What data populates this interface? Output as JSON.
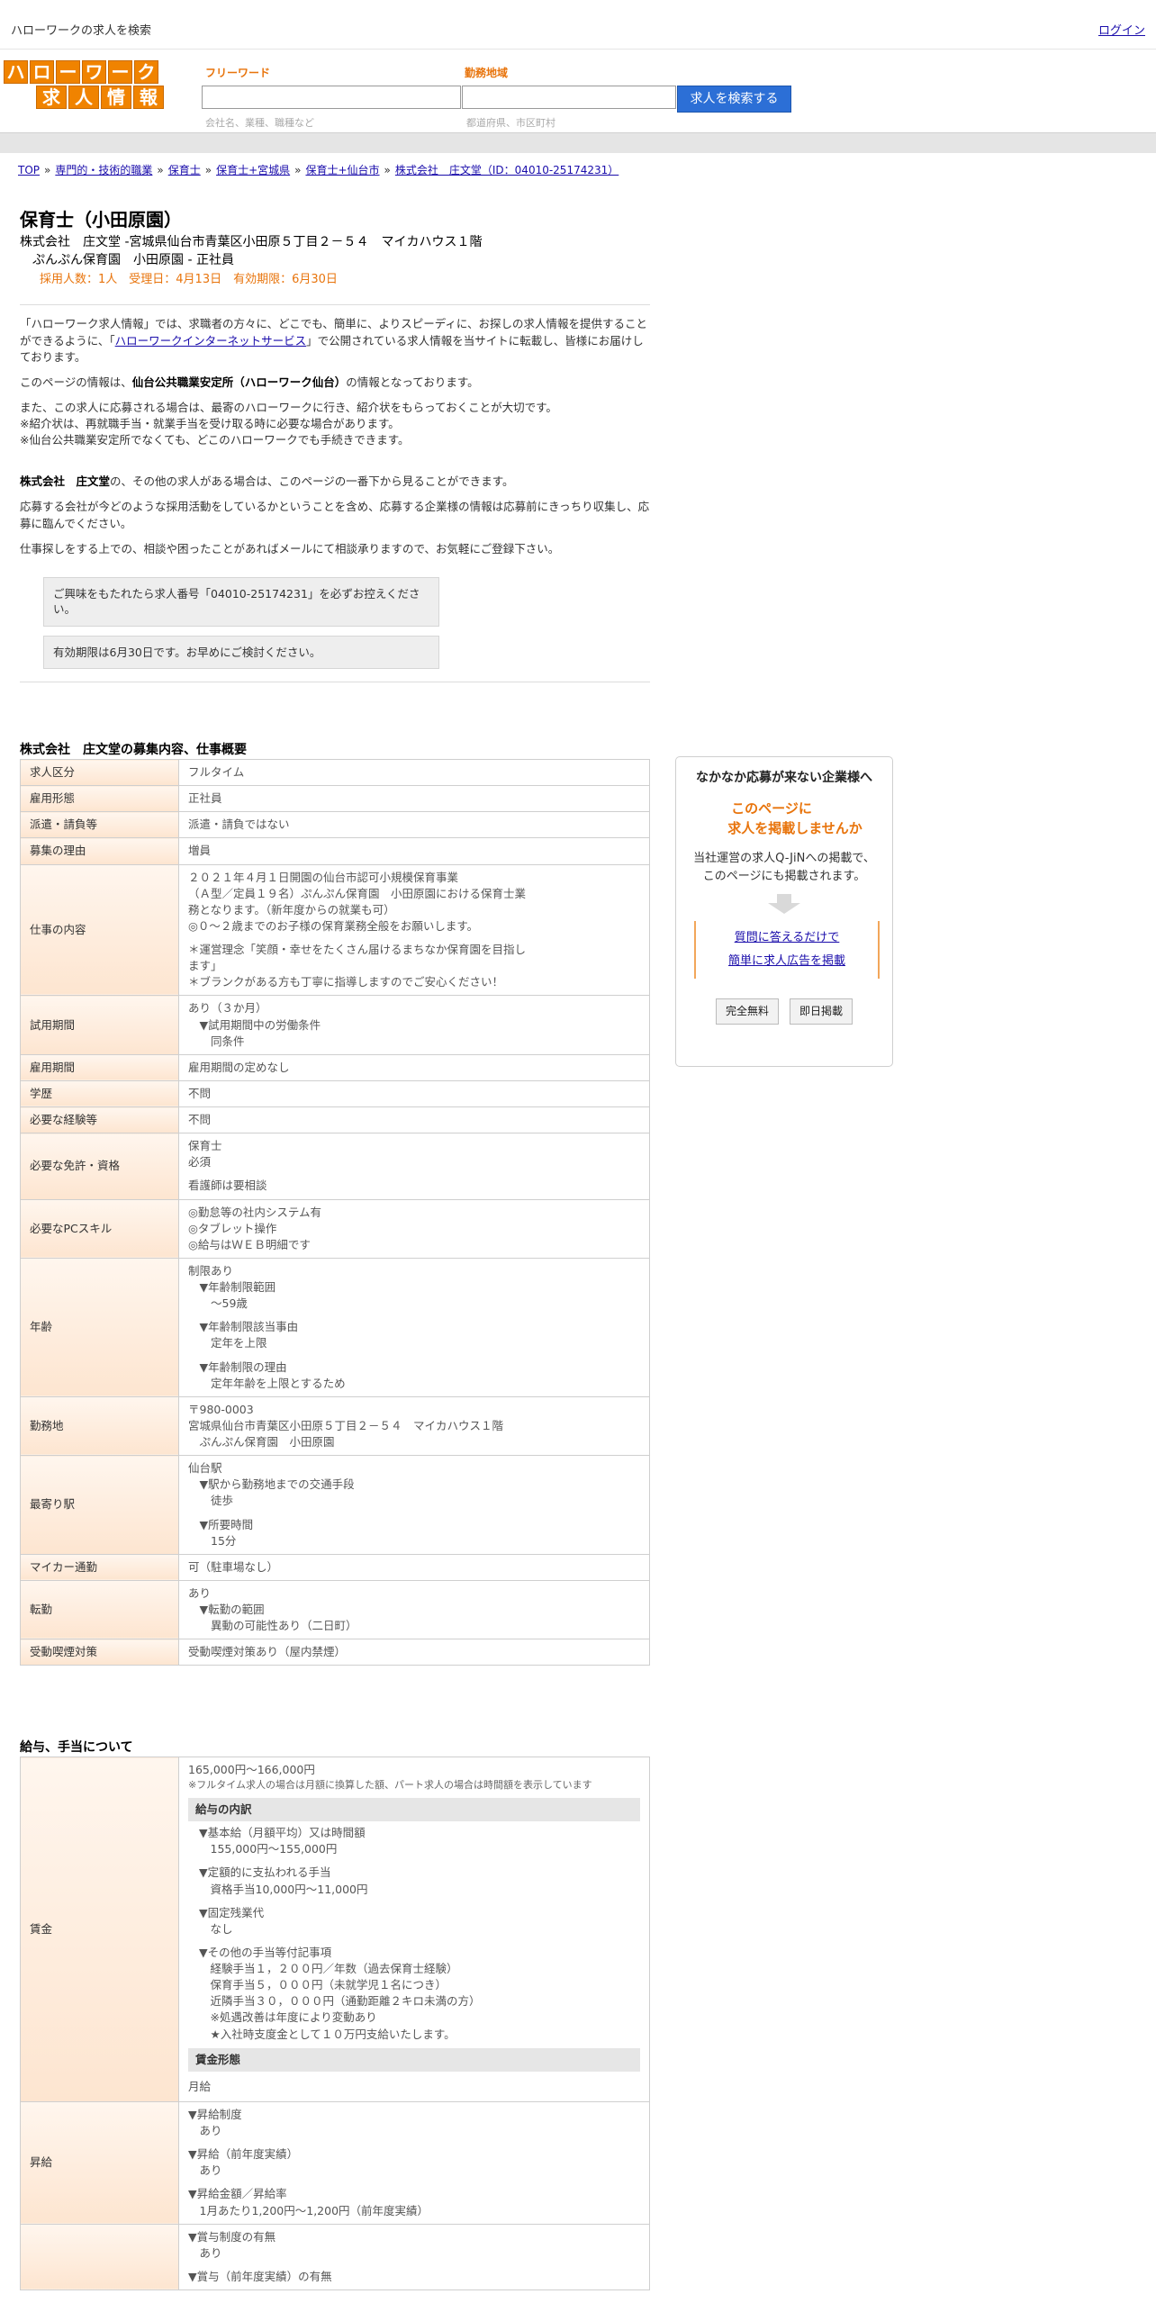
{
  "topbar": {
    "title": "ハローワークの求人を検索",
    "login": "ログイン"
  },
  "logo": {
    "row1": [
      "ハ",
      "ロ",
      "ー",
      "ワ",
      "ー",
      "ク"
    ],
    "row2": [
      "求",
      "人",
      "情",
      "報"
    ]
  },
  "search": {
    "freeword_label": "フリーワード",
    "freeword_hint": "会社名、業種、職種など",
    "area_label": "勤務地域",
    "area_hint": "都道府県、市区町村",
    "button": "求人を検索する"
  },
  "breadcrumb": [
    "TOP",
    "専門的・技術的職業",
    "保育士",
    "保育士+宮城県",
    "保育士+仙台市",
    "株式会社　庄文堂（ID：04010-25174231）"
  ],
  "breadcrumb_sep": "»",
  "job": {
    "title": "保育士（小田原園）",
    "company": "株式会社　庄文堂 -宮城県仙台市青葉区小田原５丁目２－５４　マイカハウス１階",
    "sub": "ぷんぷん保育園　小田原園 - 正社員",
    "meta": "採用人数：1人　受理日：4月13日　有効期限：6月30日"
  },
  "intro": {
    "p1a": "「ハローワーク求人情報」では、求職者の方々に、どこでも、簡単に、よりスピーディに、お探しの求人情報を提供することができるように、「",
    "p1link": "ハローワークインターネットサービス",
    "p1b": "」で公開されている求人情報を当サイトに転載し、皆様にお届けしております。",
    "p2a": "このページの情報は、",
    "p2b": "仙台公共職業安定所（ハローワーク仙台）",
    "p2c": "の情報となっております。",
    "p3": "また、この求人に応募される場合は、最寄のハローワークに行き、紹介状をもらっておくことが大切です。",
    "p3n1": "※紹介状は、再就職手当・就業手当を受け取る時に必要な場合があります。",
    "p3n2": "※仙台公共職業安定所でなくても、どこのハローワークでも手続きできます。",
    "p4a": "株式会社　庄文堂",
    "p4b": "の、その他の求人がある場合は、このページの一番下から見ることができます。",
    "p5": "応募する会社が今どのような採用活動をしているかということを含め、応募する企業様の情報は応募前にきっちり収集し、応募に臨んでください。",
    "p6": "仕事探しをする上での、相談や困ったことがあればメールにて相談承りますので、お気軽にご登録下さい。",
    "notice1": "ご興味をもたれたら求人番号「04010-25174231」を必ずお控えください。",
    "notice2": "有効期限は6月30日です。お早めにご検討ください。"
  },
  "overview": {
    "title": "株式会社　庄文堂の募集内容、仕事概要",
    "rows": [
      {
        "k": "求人区分",
        "v": [
          "フルタイム"
        ]
      },
      {
        "k": "雇用形態",
        "v": [
          "正社員"
        ]
      },
      {
        "k": "派遣・請負等",
        "v": [
          "派遣・請負ではない"
        ]
      },
      {
        "k": "募集の理由",
        "v": [
          "増員"
        ]
      },
      {
        "k": "仕事の内容",
        "v": [
          "２０２１年４月１日開園の仙台市認可小規模保育事業",
          "（Ａ型／定員１９名）ぷんぷん保育園　小田原園における保育士業",
          "務となります。（新年度からの就業も可）",
          "◎０～２歳までのお子様の保育業務全般をお願いします。",
          "",
          "＊運営理念「笑顔・幸せをたくさん届けるまちなか保育園を目指し",
          "ます」",
          "＊ブランクがある方も丁寧に指導しますのでご安心ください！"
        ]
      },
      {
        "k": "試用期間",
        "v": [
          "あり（３か月）",
          "　▼試用期間中の労働条件",
          "　　同条件"
        ]
      },
      {
        "k": "雇用期間",
        "v": [
          "雇用期間の定めなし"
        ]
      },
      {
        "k": "学歴",
        "v": [
          "不問"
        ]
      },
      {
        "k": "必要な経験等",
        "v": [
          "不問"
        ]
      },
      {
        "k": "必要な免許・資格",
        "v": [
          "保育士",
          "必須",
          "",
          "看護師は要相談"
        ]
      },
      {
        "k": "必要なPCスキル",
        "v": [
          "◎勤怠等の社内システム有",
          "◎タブレット操作",
          "◎給与はＷＥＢ明細です"
        ]
      },
      {
        "k": "年齢",
        "v": [
          "制限あり",
          "　▼年齢制限範囲",
          "　　〜59歳",
          "",
          "　▼年齢制限該当事由",
          "　　定年を上限",
          "",
          "　▼年齢制限の理由",
          "　　定年年齢を上限とするため"
        ]
      },
      {
        "k": "勤務地",
        "v": [
          "〒980-0003",
          "宮城県仙台市青葉区小田原５丁目２－５４　マイカハウス１階",
          "　ぷんぷん保育園　小田原園"
        ]
      },
      {
        "k": "最寄り駅",
        "v": [
          "仙台駅",
          "　▼駅から勤務地までの交通手段",
          "　　徒歩",
          "",
          "　▼所要時間",
          "　　15分"
        ]
      },
      {
        "k": "マイカー通勤",
        "v": [
          "可（駐車場なし）"
        ]
      },
      {
        "k": "転勤",
        "v": [
          "あり",
          "　▼転勤の範囲",
          "　　異動の可能性あり（二日町）"
        ]
      },
      {
        "k": "受動喫煙対策",
        "v": [
          "受動喫煙対策あり（屋内禁煙）"
        ]
      }
    ]
  },
  "salary": {
    "title": "給与、手当について",
    "wage_label": "賃金",
    "wage_range": "165,000円〜166,000円",
    "wage_note": "※フルタイム求人の場合は月額に換算した額、パート求人の場合は時間額を表示しています",
    "breakdown_head": "給与の内訳",
    "breakdown": [
      "▼基本給（月額平均）又は時間額",
      "　155,000円〜155,000円",
      "",
      "▼定額的に支払われる手当",
      "　資格手当10,000円〜11,000円",
      "",
      "▼固定残業代",
      "　なし",
      "",
      "▼その他の手当等付記事項",
      "　経験手当１，２００円／年数（過去保育士経験）",
      "　保育手当５，０００円（未就学児１名につき）",
      "　近隣手当３０，０００円（通勤距離２キロ未満の方）",
      "　※処遇改善は年度により変動あり",
      "　★入社時支度金として１０万円支給いたします。"
    ],
    "form_head": "賃金形態",
    "form_value": "月給",
    "raise_label": "昇給",
    "raise": [
      "▼昇給制度",
      "　あり",
      "",
      "▼昇給（前年度実績）",
      "　あり",
      "",
      "▼昇給金額／昇給率",
      "　1月あたり1,200円〜1,200円（前年度実績）"
    ],
    "bonus": [
      "▼賞与制度の有無",
      "　あり",
      "",
      "▼賞与（前年度実績）の有無"
    ]
  },
  "ad": {
    "title": "なかなか応募が来ない企業様へ",
    "catch1": "このページに",
    "catch2": "求人を掲載しませんか",
    "desc1": "当社運営の求人Q-JiNへの掲載で、",
    "desc2": "このページにも掲載されます。",
    "link1": "質問に答えるだけで",
    "link2": "簡単に求人広告を掲載",
    "btn1": "完全無料",
    "btn2": "即日掲載"
  },
  "colors": {
    "accent": "#e8740c",
    "logo": "#f08300",
    "button": "#2c6fd6"
  }
}
